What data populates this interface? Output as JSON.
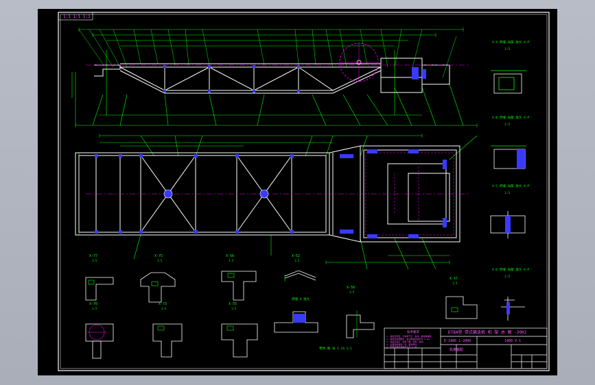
{
  "colors": {
    "canvas_bg": "#000000",
    "frame": "#ffffff",
    "geometry": "#ffffff",
    "dimension": "#00ff00",
    "centerline": "#ff00ff",
    "hidden": "#ff00ff",
    "weld": "#3a3aff",
    "section_fill": "#3a3aff",
    "title_text": "#ff55ff"
  },
  "drawing": {
    "corner_tag": "1:1 1:1 1:1",
    "title_block": {
      "main_title": "DT8A型 带式输送机 机 架 总 图 -2002",
      "drawing_no": "D-1400 1-2000",
      "scale": "1400 V-1",
      "part_name": "机架装配",
      "notes_header": "技术要求",
      "notes": [
        "1. 焊接应牢固，不得有气孔、夹渣、裂纹等缺陷。",
        "2. 焊缝高度按图示，未注焊缝高度均为 6 mm。",
        "3. 焊后应校正，去除飞溅、毛刺、焊渣。",
        "4. 表面涂防锈漆一道，面漆两道。",
        "5. 机架对角线误差不大于 5 mm。"
      ]
    },
    "section_views": [
      {
        "id": "sec-77",
        "label": "X-77",
        "scale": "1:5"
      },
      {
        "id": "sec-75",
        "label": "X-75",
        "scale": "1:5"
      },
      {
        "id": "sec-56",
        "label": "X-56",
        "scale": "1:5"
      },
      {
        "id": "sec-52",
        "label": "X-52",
        "scale": "1:5"
      },
      {
        "id": "sec-76",
        "label": "X-76",
        "scale": "1:5"
      },
      {
        "id": "sec-73",
        "label": "X-73",
        "scale": "1:5"
      },
      {
        "id": "sec-55",
        "label": "X-55",
        "scale": "1:5"
      },
      {
        "id": "sec-58",
        "label": "X-58",
        "scale": "1:5"
      },
      {
        "id": "sec-57",
        "label": "X-57",
        "scale": "1:5"
      }
    ],
    "right_details": [
      {
        "id": "det-a",
        "label": "X-A 焊缝 局部 放大 X-P",
        "scale": "1:5"
      },
      {
        "id": "det-b",
        "label": "X-B 焊缝 局部 放大 X-P",
        "scale": "1:5"
      },
      {
        "id": "det-c",
        "label": "X-C 焊缝 局部 放大 X-P",
        "scale": "1:5"
      },
      {
        "id": "det-d",
        "label": "X-D 焊缝 局部 放大 X-P",
        "scale": "1:5"
      }
    ],
    "weld_note": "焊缝 A 放大",
    "bottom_note": "零件 图 号 1-14 1:1"
  }
}
